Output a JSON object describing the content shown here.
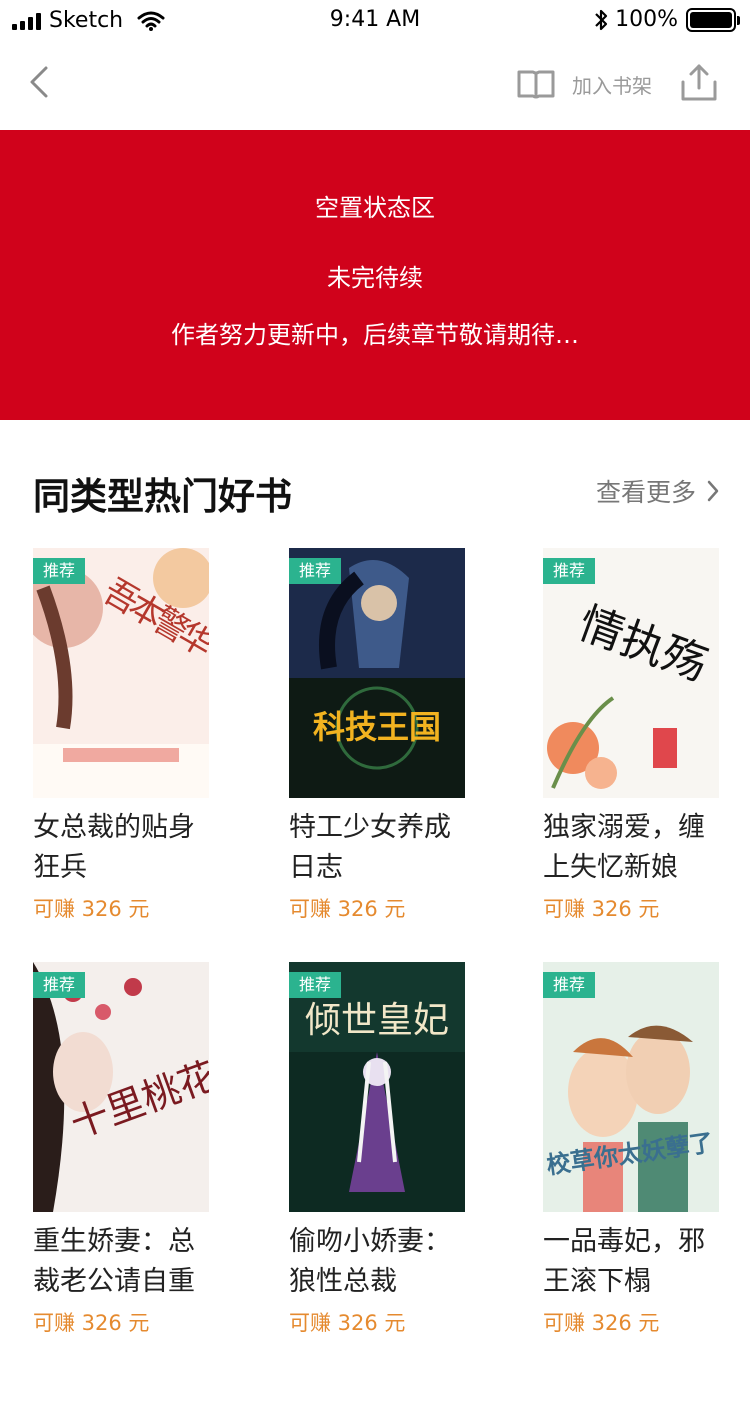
{
  "status_bar": {
    "carrier": "Sketch",
    "time": "9:41 AM",
    "battery": "100%"
  },
  "nav": {
    "add_to_shelf_label": "加入书架"
  },
  "empty_state": {
    "title": "空置状态区",
    "subtitle": "未完待续",
    "description": "作者努力更新中，后续章节敬请期待…",
    "background_color": "#d0021b"
  },
  "section": {
    "title": "同类型热门好书",
    "more_label": "查看更多"
  },
  "colors": {
    "tag": "#2bb38f",
    "earn": "#e58a2f"
  },
  "books": [
    {
      "tag": "推荐",
      "title_line1": "女总裁的贴身",
      "title_line2": "狂兵",
      "earn": "可赚 326 元",
      "cover_text": "吾本警华"
    },
    {
      "tag": "推荐",
      "title_line1": "特工少女养成",
      "title_line2": "日志",
      "earn": "可赚 326 元",
      "cover_text": "科技王国"
    },
    {
      "tag": "推荐",
      "title_line1": "独家溺爱，缠",
      "title_line2": "上失忆新娘",
      "earn": "可赚 326 元",
      "cover_text": "情执殇"
    },
    {
      "tag": "推荐",
      "title_line1": "重生娇妻：总",
      "title_line2": "裁老公请自重",
      "earn": "可赚 326 元",
      "cover_text": "十里桃花"
    },
    {
      "tag": "推荐",
      "title_line1": "偷吻小娇妻：",
      "title_line2": "狼性总裁",
      "earn": "可赚 326 元",
      "cover_text": "倾世皇妃"
    },
    {
      "tag": "推荐",
      "title_line1": "一品毒妃，邪",
      "title_line2": "王滚下榻",
      "earn": "可赚 326 元",
      "cover_text": "校草你太妖孽了"
    }
  ]
}
